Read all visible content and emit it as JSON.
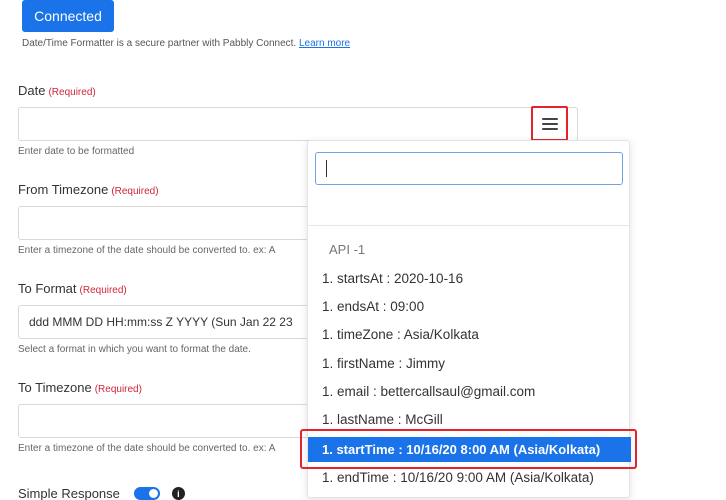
{
  "header": {
    "connected_label": "Connected",
    "partner_text": "Date/Time Formatter is a secure partner with Pabbly Connect.",
    "learn_more": "Learn more"
  },
  "fields": {
    "date": {
      "label": "Date",
      "required": "(Required)",
      "value": "",
      "help": "Enter date to be formatted"
    },
    "from_timezone": {
      "label": "From Timezone",
      "required": "(Required)",
      "value": "",
      "help": "Enter a timezone of the date should be converted to. ex: A"
    },
    "to_format": {
      "label": "To Format",
      "required": "(Required)",
      "value": "ddd MMM DD HH:mm:ss Z YYYY (Sun Jan 22 23",
      "help": "Select a format in which you want to format the date."
    },
    "to_timezone": {
      "label": "To Timezone",
      "required": "(Required)",
      "value": "",
      "help": "Enter a timezone of the date should be converted to. ex: A"
    }
  },
  "simple_response": {
    "label": "Simple Response",
    "enabled": true,
    "info_icon": "info-circle-icon"
  },
  "dropdown": {
    "search_value": "",
    "group_label": "API -1",
    "items": [
      "1. startsAt : 2020-10-16",
      "1. endsAt : 09:00",
      "1. timeZone : Asia/Kolkata",
      "1. firstName : Jimmy",
      "1. email : bettercallsaul@gmail.com",
      "1. lastName : McGill",
      "1. startTime : 10/16/20 8:00 AM (Asia/Kolkata)",
      "1. endTime : 10/16/20 9:00 AM (Asia/Kolkata)"
    ],
    "selected_index": 6
  },
  "colors": {
    "accent": "#1a73e8",
    "required": "#d0263a",
    "highlight_outline": "#e3242b"
  }
}
